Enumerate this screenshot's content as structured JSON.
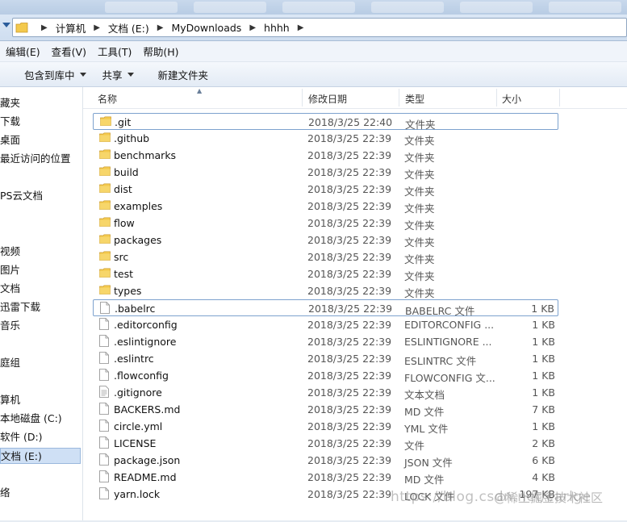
{
  "address": {
    "crumbs": [
      "计算机",
      "文档 (E:)",
      "MyDownloads",
      "hhhh"
    ]
  },
  "menu": [
    "编辑(E)",
    "查看(V)",
    "工具(T)",
    "帮助(H)"
  ],
  "toolbar": {
    "include_label": "包含到库中",
    "share_label": "共享",
    "new_folder_label": "新建文件夹"
  },
  "sidebar": {
    "items": [
      {
        "label": "藏夹"
      },
      {
        "label": "下载"
      },
      {
        "label": "桌面"
      },
      {
        "label": "最近访问的位置"
      },
      {
        "label": "PS云文档"
      },
      {
        "label": "视频"
      },
      {
        "label": "图片"
      },
      {
        "label": "文档"
      },
      {
        "label": "迅雷下载"
      },
      {
        "label": "音乐"
      },
      {
        "label": "庭组"
      },
      {
        "label": "算机"
      },
      {
        "label": "本地磁盘 (C:)"
      },
      {
        "label": "软件 (D:)"
      },
      {
        "label": "文档 (E:)"
      },
      {
        "label": "络"
      }
    ]
  },
  "columns": {
    "name": "名称",
    "date": "修改日期",
    "type": "类型",
    "size": "大小"
  },
  "files": [
    {
      "name": ".git",
      "date": "2018/3/25 22:40",
      "type": "文件夹",
      "size": "",
      "kind": "folder"
    },
    {
      "name": ".github",
      "date": "2018/3/25 22:39",
      "type": "文件夹",
      "size": "",
      "kind": "folder"
    },
    {
      "name": "benchmarks",
      "date": "2018/3/25 22:39",
      "type": "文件夹",
      "size": "",
      "kind": "folder"
    },
    {
      "name": "build",
      "date": "2018/3/25 22:39",
      "type": "文件夹",
      "size": "",
      "kind": "folder"
    },
    {
      "name": "dist",
      "date": "2018/3/25 22:39",
      "type": "文件夹",
      "size": "",
      "kind": "folder"
    },
    {
      "name": "examples",
      "date": "2018/3/25 22:39",
      "type": "文件夹",
      "size": "",
      "kind": "folder"
    },
    {
      "name": "flow",
      "date": "2018/3/25 22:39",
      "type": "文件夹",
      "size": "",
      "kind": "folder"
    },
    {
      "name": "packages",
      "date": "2018/3/25 22:39",
      "type": "文件夹",
      "size": "",
      "kind": "folder"
    },
    {
      "name": "src",
      "date": "2018/3/25 22:39",
      "type": "文件夹",
      "size": "",
      "kind": "folder"
    },
    {
      "name": "test",
      "date": "2018/3/25 22:39",
      "type": "文件夹",
      "size": "",
      "kind": "folder"
    },
    {
      "name": "types",
      "date": "2018/3/25 22:39",
      "type": "文件夹",
      "size": "",
      "kind": "folder"
    },
    {
      "name": ".babelrc",
      "date": "2018/3/25 22:39",
      "type": "BABELRC 文件",
      "size": "1 KB",
      "kind": "file"
    },
    {
      "name": ".editorconfig",
      "date": "2018/3/25 22:39",
      "type": "EDITORCONFIG ...",
      "size": "1 KB",
      "kind": "file"
    },
    {
      "name": ".eslintignore",
      "date": "2018/3/25 22:39",
      "type": "ESLINTIGNORE ...",
      "size": "1 KB",
      "kind": "file"
    },
    {
      "name": ".eslintrc",
      "date": "2018/3/25 22:39",
      "type": "ESLINTRC 文件",
      "size": "1 KB",
      "kind": "file"
    },
    {
      "name": ".flowconfig",
      "date": "2018/3/25 22:39",
      "type": "FLOWCONFIG 文...",
      "size": "1 KB",
      "kind": "file"
    },
    {
      "name": ".gitignore",
      "date": "2018/3/25 22:39",
      "type": "文本文档",
      "size": "1 KB",
      "kind": "text"
    },
    {
      "name": "BACKERS.md",
      "date": "2018/3/25 22:39",
      "type": "MD 文件",
      "size": "7 KB",
      "kind": "file"
    },
    {
      "name": "circle.yml",
      "date": "2018/3/25 22:39",
      "type": "YML 文件",
      "size": "1 KB",
      "kind": "file"
    },
    {
      "name": "LICENSE",
      "date": "2018/3/25 22:39",
      "type": "文件",
      "size": "2 KB",
      "kind": "file"
    },
    {
      "name": "package.json",
      "date": "2018/3/25 22:39",
      "type": "JSON 文件",
      "size": "6 KB",
      "kind": "file"
    },
    {
      "name": "README.md",
      "date": "2018/3/25 22:39",
      "type": "MD 文件",
      "size": "4 KB",
      "kind": "file"
    },
    {
      "name": "yarn.lock",
      "date": "2018/3/25 22:39",
      "type": "LOCK 文件",
      "size": "197 KB",
      "kind": "file"
    }
  ],
  "watermark": "https://blog.csdn.net/carlge",
  "watermark_overlay": "@稀土掘金技术社区",
  "colors": {
    "folder": "#f3c94d",
    "selection_border": "#7da2ce",
    "toolbar_bg": "#e3ebf5"
  }
}
